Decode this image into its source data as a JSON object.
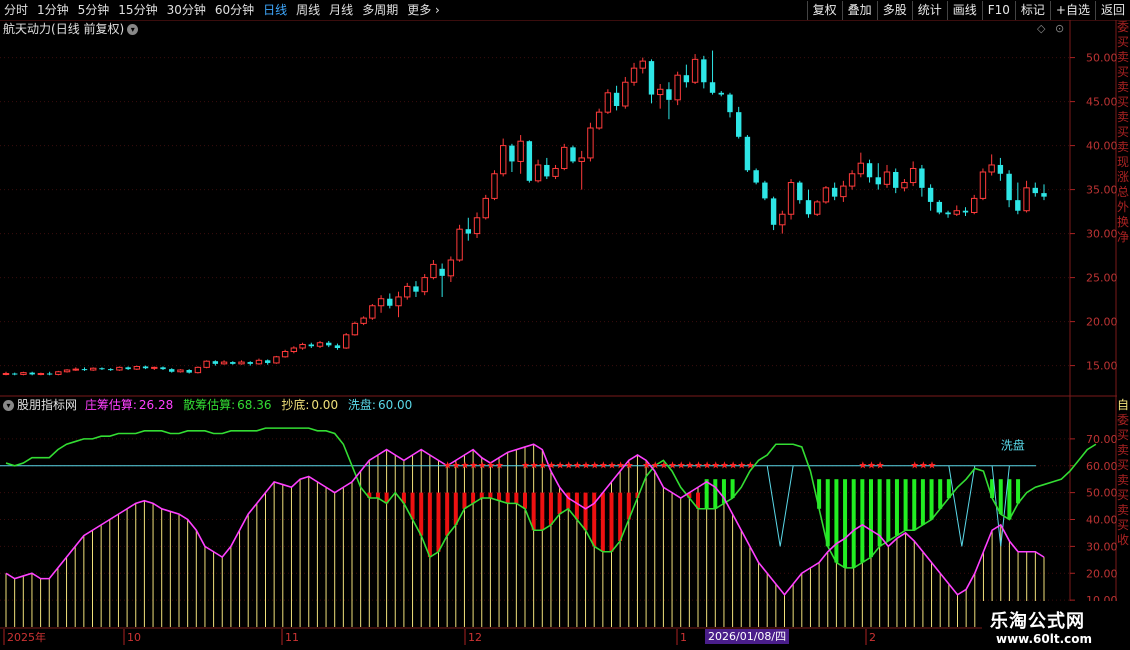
{
  "toolbar": {
    "periods": [
      "分时",
      "1分钟",
      "5分钟",
      "15分钟",
      "30分钟",
      "60分钟",
      "日线",
      "周线",
      "月线",
      "多周期",
      "更多"
    ],
    "active_period": "日线",
    "right_buttons": [
      "复权",
      "叠加",
      "多股",
      "统计",
      "画线",
      "F10",
      "标记",
      "+自选",
      "返回"
    ]
  },
  "stock": {
    "name": "航天动力",
    "mode": "(日线 前复权)"
  },
  "indicator": {
    "name": "股朋指标网",
    "zhuang_label": "庄筹估算:",
    "zhuang_value": "26.28",
    "san_label": "散筹估算:",
    "san_value": "68.36",
    "chaodi_label": "抄底:",
    "chaodi_value": "0.00",
    "xipan_label": "洗盘:",
    "xipan_value": "60.00",
    "xipan_annotations": [
      "洗盘",
      "洗盘"
    ]
  },
  "side_text_top": [
    "委",
    "买",
    "卖",
    "买",
    "卖",
    "买",
    "卖",
    "买",
    "卖",
    "现",
    "涨",
    "总",
    "外",
    "换",
    "净"
  ],
  "side_text_ind": [
    "自",
    "委",
    "买",
    "卖",
    "买",
    "卖",
    "买",
    "卖",
    "买",
    "收"
  ],
  "time_axis": {
    "labels": [
      "2025年",
      "10",
      "11",
      "12",
      "1",
      "2"
    ],
    "cursor_date": "2026/01/08/四"
  },
  "watermark": {
    "line1": "乐淘公式网",
    "line2": "www.60lt.com"
  },
  "colors": {
    "up": "#ff3b3b",
    "down": "#2ee6e6",
    "bg": "#000000",
    "grid": "#3a0d0d",
    "zhuang": "#ff40ff",
    "san": "#33dd33",
    "xipan": "#5ad8e8",
    "yellow": "#f0e07a"
  },
  "chart_data": [
    {
      "type": "candlestick",
      "title": "航天动力 (日线 前复权)",
      "y_ticks": [
        "50.00",
        "45.00",
        "40.00",
        "35.00",
        "30.00",
        "25.00",
        "20.00",
        "15.00"
      ],
      "ylim": [
        12,
        52
      ],
      "candles": [
        [
          14.0,
          14.1,
          14.3,
          13.9
        ],
        [
          14.1,
          14.0,
          14.2,
          13.9
        ],
        [
          14.0,
          14.2,
          14.3,
          13.9
        ],
        [
          14.2,
          14.0,
          14.3,
          13.9
        ],
        [
          14.0,
          14.1,
          14.2,
          13.9
        ],
        [
          14.1,
          14.0,
          14.3,
          13.9
        ],
        [
          14.0,
          14.3,
          14.4,
          13.9
        ],
        [
          14.3,
          14.5,
          14.6,
          14.2
        ],
        [
          14.5,
          14.6,
          14.8,
          14.4
        ],
        [
          14.6,
          14.5,
          14.8,
          14.4
        ],
        [
          14.5,
          14.7,
          14.8,
          14.4
        ],
        [
          14.7,
          14.6,
          14.8,
          14.5
        ],
        [
          14.6,
          14.5,
          14.7,
          14.4
        ],
        [
          14.5,
          14.8,
          14.9,
          14.4
        ],
        [
          14.8,
          14.6,
          14.9,
          14.5
        ],
        [
          14.6,
          14.9,
          15.0,
          14.5
        ],
        [
          14.9,
          14.7,
          15.0,
          14.6
        ],
        [
          14.7,
          14.8,
          14.9,
          14.5
        ],
        [
          14.8,
          14.6,
          14.9,
          14.5
        ],
        [
          14.6,
          14.3,
          14.7,
          14.2
        ],
        [
          14.3,
          14.5,
          14.6,
          14.2
        ],
        [
          14.5,
          14.2,
          14.6,
          14.1
        ],
        [
          14.2,
          14.8,
          14.9,
          14.1
        ],
        [
          14.8,
          15.5,
          15.6,
          14.7
        ],
        [
          15.5,
          15.2,
          15.6,
          15.0
        ],
        [
          15.2,
          15.4,
          15.6,
          15.1
        ],
        [
          15.4,
          15.2,
          15.5,
          15.1
        ],
        [
          15.2,
          15.4,
          15.6,
          15.1
        ],
        [
          15.4,
          15.2,
          15.5,
          15.0
        ],
        [
          15.2,
          15.6,
          15.8,
          15.1
        ],
        [
          15.6,
          15.3,
          15.7,
          15.1
        ],
        [
          15.3,
          16.0,
          16.1,
          15.2
        ],
        [
          16.0,
          16.6,
          16.8,
          15.9
        ],
        [
          16.6,
          17.0,
          17.2,
          16.4
        ],
        [
          17.0,
          17.4,
          17.6,
          16.8
        ],
        [
          17.4,
          17.2,
          17.6,
          17.0
        ],
        [
          17.2,
          17.6,
          17.8,
          17.0
        ],
        [
          17.6,
          17.3,
          17.8,
          17.1
        ],
        [
          17.3,
          17.0,
          17.5,
          16.8
        ],
        [
          17.0,
          18.5,
          18.7,
          16.9
        ],
        [
          18.5,
          19.8,
          20.0,
          18.4
        ],
        [
          19.8,
          20.4,
          20.6,
          19.6
        ],
        [
          20.4,
          21.8,
          22.0,
          20.2
        ],
        [
          21.8,
          22.6,
          23.0,
          21.0
        ],
        [
          22.6,
          21.8,
          23.2,
          21.5
        ],
        [
          21.8,
          22.8,
          23.4,
          20.5
        ],
        [
          22.8,
          24.0,
          24.4,
          22.5
        ],
        [
          24.0,
          23.4,
          24.6,
          22.8
        ],
        [
          23.4,
          25.0,
          25.4,
          23.0
        ],
        [
          25.0,
          26.5,
          27.0,
          24.8
        ],
        [
          26.0,
          25.2,
          26.6,
          22.8
        ],
        [
          25.2,
          27.0,
          27.4,
          24.5
        ],
        [
          27.0,
          30.5,
          31.0,
          26.8
        ],
        [
          30.5,
          30.0,
          31.8,
          29.2
        ],
        [
          30.0,
          31.8,
          32.4,
          29.5
        ],
        [
          31.8,
          34.0,
          34.4,
          31.6
        ],
        [
          34.0,
          36.8,
          37.2,
          33.8
        ],
        [
          36.8,
          40.0,
          40.8,
          36.5
        ],
        [
          40.0,
          38.2,
          40.2,
          37.0
        ],
        [
          38.2,
          40.5,
          41.2,
          36.8
        ],
        [
          40.5,
          36.0,
          40.6,
          35.8
        ],
        [
          36.0,
          37.8,
          38.4,
          35.8
        ],
        [
          37.8,
          36.5,
          38.6,
          36.2
        ],
        [
          36.5,
          37.4,
          37.8,
          36.2
        ],
        [
          37.4,
          39.8,
          40.2,
          37.2
        ],
        [
          39.8,
          38.2,
          40.0,
          38.0
        ],
        [
          38.2,
          38.6,
          39.4,
          35.0
        ],
        [
          38.6,
          42.0,
          42.6,
          38.2
        ],
        [
          42.0,
          43.8,
          44.2,
          41.8
        ],
        [
          43.8,
          46.0,
          46.4,
          43.6
        ],
        [
          46.0,
          44.5,
          46.8,
          44.0
        ],
        [
          44.5,
          47.2,
          47.8,
          44.2
        ],
        [
          47.2,
          48.8,
          49.4,
          46.8
        ],
        [
          48.8,
          49.6,
          50.0,
          48.2
        ],
        [
          49.6,
          45.8,
          49.8,
          44.8
        ],
        [
          45.8,
          46.4,
          47.0,
          44.2
        ],
        [
          46.4,
          45.2,
          47.2,
          43.0
        ],
        [
          45.2,
          48.0,
          48.4,
          44.6
        ],
        [
          48.0,
          47.2,
          49.2,
          46.6
        ],
        [
          47.2,
          49.8,
          50.4,
          47.0
        ],
        [
          49.8,
          47.2,
          50.2,
          46.5
        ],
        [
          47.2,
          46.0,
          50.8,
          45.8
        ],
        [
          46.0,
          45.8,
          46.2,
          45.6
        ],
        [
          45.8,
          43.8,
          46.0,
          43.2
        ],
        [
          43.8,
          41.0,
          44.4,
          40.8
        ],
        [
          41.0,
          37.2,
          41.2,
          37.0
        ],
        [
          37.2,
          35.8,
          37.4,
          35.6
        ],
        [
          35.8,
          34.0,
          36.0,
          33.8
        ],
        [
          34.0,
          31.0,
          34.2,
          30.4
        ],
        [
          31.0,
          32.2,
          32.6,
          30.0
        ],
        [
          32.2,
          35.8,
          36.2,
          31.6
        ],
        [
          35.8,
          33.8,
          36.0,
          33.4
        ],
        [
          33.8,
          32.2,
          35.0,
          31.8
        ],
        [
          32.2,
          33.6,
          33.8,
          32.0
        ],
        [
          33.6,
          35.2,
          35.4,
          33.4
        ],
        [
          35.2,
          34.2,
          35.8,
          33.8
        ],
        [
          34.2,
          35.4,
          36.0,
          33.6
        ],
        [
          35.4,
          36.8,
          37.2,
          35.0
        ],
        [
          36.8,
          38.0,
          39.2,
          36.4
        ],
        [
          38.0,
          36.4,
          38.4,
          35.8
        ],
        [
          36.4,
          35.6,
          38.0,
          35.0
        ],
        [
          35.6,
          37.0,
          37.8,
          35.2
        ],
        [
          37.0,
          35.2,
          37.4,
          34.6
        ],
        [
          35.2,
          35.8,
          36.2,
          34.8
        ],
        [
          35.8,
          37.4,
          38.2,
          35.4
        ],
        [
          37.4,
          35.2,
          37.8,
          34.2
        ],
        [
          35.2,
          33.6,
          35.6,
          32.6
        ],
        [
          33.6,
          32.4,
          33.8,
          32.2
        ],
        [
          32.4,
          32.2,
          32.6,
          31.8
        ],
        [
          32.2,
          32.6,
          33.2,
          32.0
        ],
        [
          32.6,
          32.4,
          33.0,
          32.0
        ],
        [
          32.4,
          34.0,
          34.4,
          32.2
        ],
        [
          34.0,
          37.0,
          37.4,
          33.8
        ],
        [
          37.0,
          37.8,
          39.0,
          36.6
        ],
        [
          37.8,
          36.8,
          38.6,
          36.0
        ],
        [
          36.8,
          33.8,
          37.2,
          33.0
        ],
        [
          33.8,
          32.6,
          35.8,
          32.2
        ],
        [
          32.6,
          35.2,
          36.0,
          32.4
        ],
        [
          35.2,
          34.6,
          35.8,
          34.2
        ],
        [
          34.6,
          34.2,
          35.6,
          33.8
        ]
      ]
    },
    {
      "type": "line",
      "title": "股朋指标网",
      "y_ticks": [
        "70.00",
        "60.00",
        "50.00",
        "40.00",
        "30.00",
        "20.00",
        "10.00"
      ],
      "ylim": [
        0,
        80
      ],
      "series": [
        {
          "name": "庄筹估算",
          "values": [
            20,
            18,
            19,
            20,
            18,
            18,
            22,
            26,
            30,
            34,
            36,
            38,
            40,
            42,
            44,
            46,
            47,
            46,
            44,
            43,
            42,
            40,
            36,
            30,
            28,
            26,
            30,
            36,
            42,
            46,
            50,
            54,
            53,
            52,
            55,
            56,
            54,
            52,
            50,
            52,
            54,
            58,
            62,
            64,
            66,
            64,
            62,
            64,
            66,
            64,
            62,
            60,
            62,
            64,
            66,
            63,
            61,
            63,
            65,
            66,
            67,
            68,
            66,
            58,
            52,
            48,
            46,
            44,
            46,
            50,
            54,
            58,
            62,
            64,
            62,
            58,
            52,
            50,
            48,
            50,
            52,
            54,
            52,
            48,
            42,
            36,
            30,
            24,
            20,
            16,
            12,
            16,
            20,
            22,
            24,
            28,
            31,
            33,
            36,
            38,
            36,
            34,
            30,
            33,
            35,
            32,
            28,
            24,
            20,
            16,
            12,
            14,
            20,
            28,
            36,
            38,
            32,
            28,
            28,
            28,
            26
          ]
        },
        {
          "name": "散筹估算",
          "values": [
            61,
            60,
            61,
            63,
            63,
            63,
            66,
            68,
            69,
            70,
            70,
            71,
            71,
            72,
            72,
            72,
            73,
            73,
            73,
            72,
            72,
            73,
            73,
            73,
            72,
            72,
            73,
            73,
            73,
            73,
            74,
            74,
            74,
            74,
            74,
            74,
            73,
            73,
            72,
            68,
            60,
            52,
            48,
            48,
            46,
            50,
            46,
            40,
            34,
            26,
            28,
            34,
            38,
            44,
            46,
            48,
            48,
            47,
            46,
            46,
            44,
            36,
            36,
            38,
            42,
            44,
            40,
            36,
            30,
            28,
            28,
            32,
            40,
            48,
            56,
            60,
            62,
            58,
            52,
            48,
            44,
            44,
            44,
            46,
            48,
            52,
            58,
            62,
            64,
            68,
            68,
            68,
            67,
            58,
            44,
            30,
            24,
            22,
            22,
            24,
            26,
            30,
            32,
            34,
            36,
            36,
            38,
            40,
            44,
            48,
            52,
            55,
            59,
            58,
            48,
            42,
            40,
            46,
            50,
            52,
            53,
            54,
            55,
            58,
            62,
            66,
            68
          ]
        },
        {
          "name": "洗盘",
          "values": []
        }
      ]
    }
  ]
}
